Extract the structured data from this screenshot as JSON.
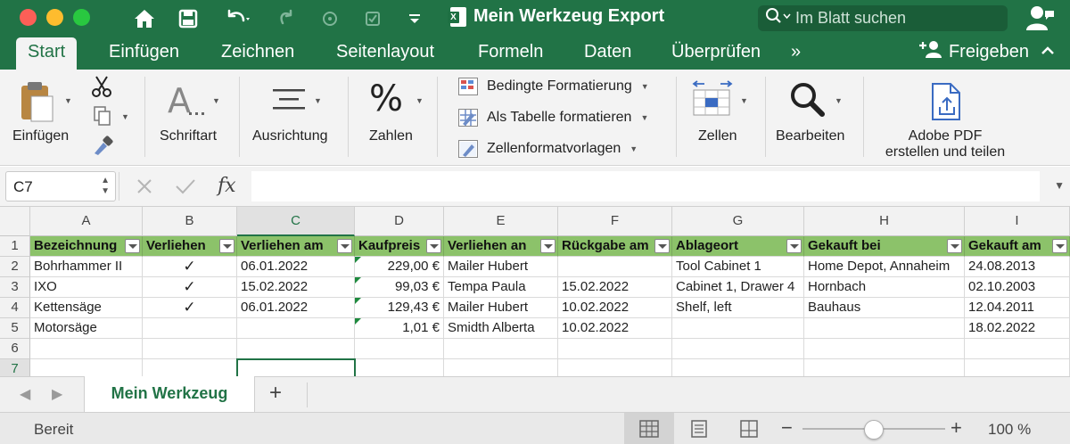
{
  "window": {
    "title": "Mein Werkzeug Export"
  },
  "search": {
    "placeholder": "Im Blatt suchen"
  },
  "tabs": [
    "Start",
    "Einfügen",
    "Zeichnen",
    "Seitenlayout",
    "Formeln",
    "Daten",
    "Überprüfen"
  ],
  "tabs_overflow": "»",
  "share_label": "Freigeben",
  "ribbon": {
    "paste": "Einfügen",
    "font": "Schriftart",
    "alignment": "Ausrichtung",
    "number": "Zahlen",
    "conditional_formatting": "Bedingte Formatierung",
    "format_as_table": "Als Tabelle formatieren",
    "cell_styles": "Zellenformatvorlagen",
    "cells": "Zellen",
    "editing": "Bearbeiten",
    "adobe_line1": "Adobe PDF",
    "adobe_line2": "erstellen und teilen"
  },
  "formula_bar": {
    "name_box": "C7",
    "formula": ""
  },
  "sheet": {
    "columns": [
      "A",
      "B",
      "C",
      "D",
      "E",
      "F",
      "G",
      "H",
      "I"
    ],
    "rows": [
      "1",
      "2",
      "3",
      "4",
      "5",
      "6",
      "7"
    ],
    "headers": [
      "Bezeichnung",
      "Verliehen",
      "Verliehen am",
      "Kaufpreis",
      "Verliehen an",
      "Rückgabe am",
      "Ablageort",
      "Gekauft bei",
      "Gekauft am"
    ],
    "data": [
      [
        "Bohrhammer II",
        "✓",
        "06.01.2022",
        "229,00 €",
        "Mailer Hubert",
        "",
        "Tool Cabinet 1",
        "Home Depot, Annaheim",
        "24.08.2013"
      ],
      [
        "IXO",
        "✓",
        "15.02.2022",
        "99,03 €",
        "Tempa Paula",
        "15.02.2022",
        "Cabinet 1, Drawer 4",
        "Hornbach",
        "02.10.2003"
      ],
      [
        "Kettensäge",
        "✓",
        "06.01.2022",
        "129,43 €",
        "Mailer Hubert",
        "10.02.2022",
        "Shelf, left",
        "Bauhaus",
        "12.04.2011"
      ],
      [
        "Motorsäge",
        "",
        "",
        "1,01 €",
        "Smidth Alberta",
        "10.02.2022",
        "",
        "",
        "18.02.2022"
      ]
    ],
    "selected_cell": "C7"
  },
  "sheet_tabs": {
    "active": "Mein Werkzeug",
    "add": "+"
  },
  "status": {
    "text": "Bereit",
    "zoom": "100 %",
    "zoom_percent": 100
  },
  "colors": {
    "brand": "#217346",
    "header_fill": "#8cc26a",
    "accent": "#217346"
  }
}
